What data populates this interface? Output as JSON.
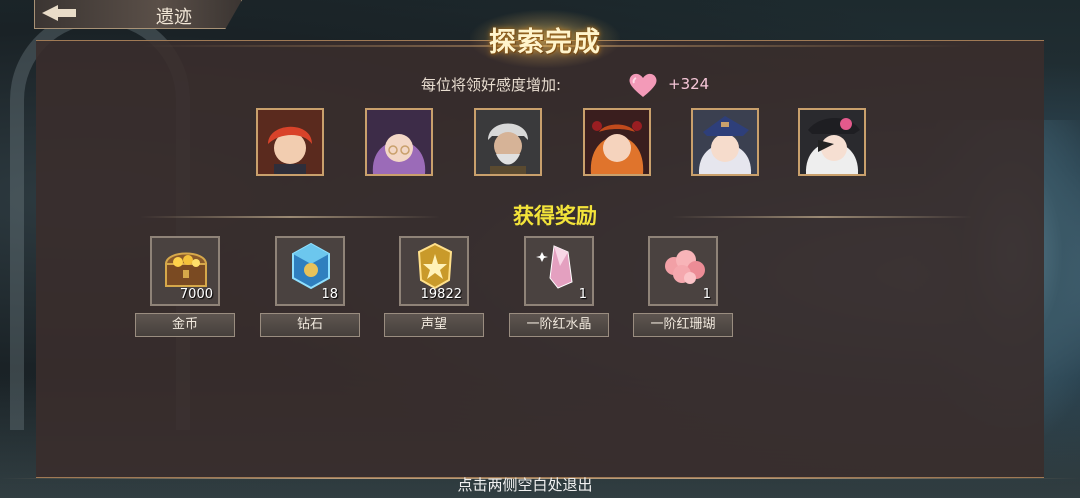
{
  "header": {
    "back_title": "遗迹"
  },
  "panel": {
    "title": "探索完成",
    "favor_label": "每位将领好感度增加:",
    "favor_value": "+324",
    "section_title": "获得奖励",
    "exit_hint": "点击两侧空白处退出"
  },
  "portraits": [
    {
      "name": "red-hair-male"
    },
    {
      "name": "purple-hair-glasses"
    },
    {
      "name": "white-hair-elder"
    },
    {
      "name": "orange-hair-female"
    },
    {
      "name": "white-hair-captain"
    },
    {
      "name": "white-hair-pink-hat"
    }
  ],
  "rewards": [
    {
      "name": "金币",
      "count": "7000",
      "icon": "treasure-chest-icon"
    },
    {
      "name": "钻石",
      "count": "18",
      "icon": "diamond-crystal-icon"
    },
    {
      "name": "声望",
      "count": "19822",
      "icon": "prestige-badge-icon"
    },
    {
      "name": "一阶红水晶",
      "count": "1",
      "icon": "red-crystal-icon"
    },
    {
      "name": "一阶红珊瑚",
      "count": "1",
      "icon": "red-coral-icon"
    }
  ],
  "colors": {
    "accent_gold": "#c9a06c",
    "section_yellow": "#f3e43a",
    "heart_pink": "#f39ab8"
  }
}
